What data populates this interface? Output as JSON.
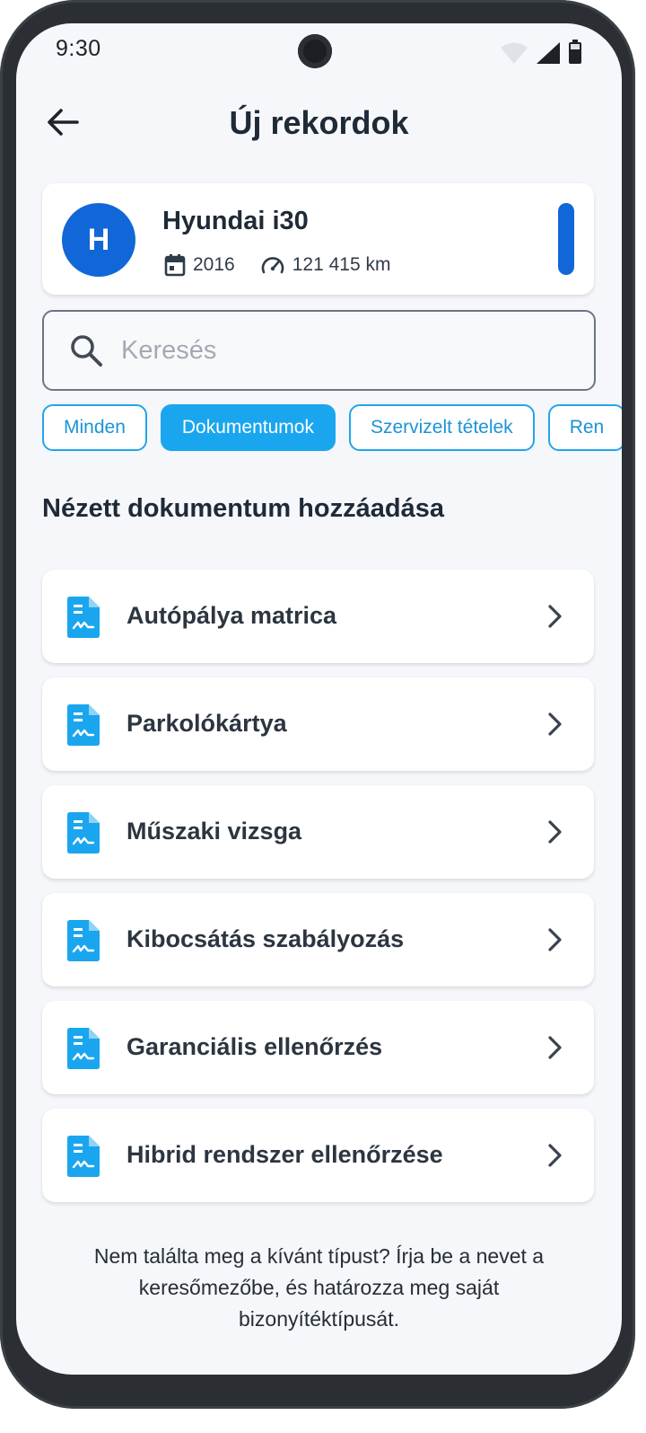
{
  "status_bar": {
    "time": "9:30"
  },
  "header": {
    "title": "Új rekordok"
  },
  "vehicle": {
    "initial": "H",
    "name": "Hyundai i30",
    "year": "2016",
    "mileage": "121 415 km"
  },
  "search": {
    "placeholder": "Keresés",
    "value": ""
  },
  "filters": [
    {
      "label": "Minden",
      "active": false
    },
    {
      "label": "Dokumentumok",
      "active": true
    },
    {
      "label": "Szervizelt tételek",
      "active": false
    },
    {
      "label": "Ren",
      "active": false
    }
  ],
  "section": {
    "title": "Nézett dokumentum hozzáadása"
  },
  "documents": [
    {
      "label": "Autópálya matrica"
    },
    {
      "label": "Parkolókártya"
    },
    {
      "label": "Műszaki vizsga"
    },
    {
      "label": "Kibocsátás szabályozás"
    },
    {
      "label": "Garanciális ellenőrzés"
    },
    {
      "label": "Hibrid rendszer ellenőrzése"
    }
  ],
  "footer": {
    "note": "Nem találta meg a kívánt típust? Írja be a nevet a keresőmezőbe, és határozza meg saját bizonyítéktípusát."
  },
  "colors": {
    "primary": "#1167d8",
    "accent": "#1aa6ef",
    "doc_icon": "#1aa6ef",
    "text": "#1f2a37",
    "background": "#f5f7fa"
  },
  "icons": {
    "back": "arrow-left-icon",
    "calendar": "calendar-icon",
    "speedometer": "speedometer-icon",
    "search": "search-icon",
    "document": "document-icon",
    "chevron": "chevron-right-icon"
  }
}
